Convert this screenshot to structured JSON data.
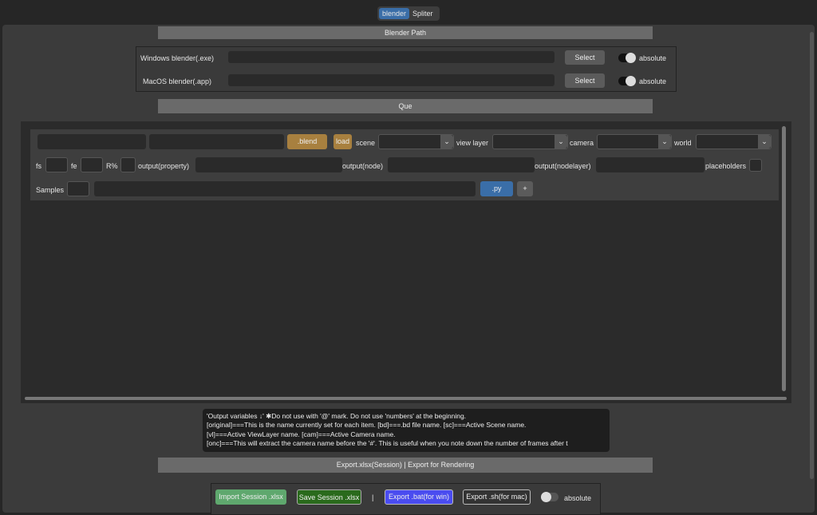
{
  "tabs": [
    {
      "label": "blender",
      "active": true
    },
    {
      "label": "Spliter",
      "active": false
    }
  ],
  "blender_path": {
    "title": "Blender Path",
    "rows": [
      {
        "label": "Windows blender(.exe)",
        "value": "",
        "button": "Select",
        "toggle_label": "absolute",
        "toggle_on": true
      },
      {
        "label": "MacOS blender(.app)",
        "value": "",
        "button": "Select",
        "toggle_label": "absolute",
        "toggle_on": true
      }
    ]
  },
  "que": {
    "title": "Que",
    "item": {
      "blend_button": ".blend",
      "load_button": "load",
      "scene_label": "scene",
      "view_layer_label": "view layer",
      "camera_label": "camera",
      "world_label": "world",
      "fs_label": "fs",
      "fe_label": "fe",
      "r_label": "R%",
      "output_property_label": "output(property)",
      "output_node_label": "output(node)",
      "output_nodelayer_label": "output(nodelayer)",
      "placeholders_label": "placeholders",
      "samples_label": "Samples",
      "py_button": ".py",
      "add_button": "+"
    }
  },
  "info": [
    "'Output variables ↓'    ✱Do not use with '@' mark. Do not use 'numbers' at the beginning.",
    "[original]===This is the name currently set for each item.      [bd]===.bd file name.      [sc]===Active Scene name.",
    "[vl]===Active ViewLayer name.      [cam]===Active Camera name.",
    "[onc]===This will extract the camera name before the '#'. This is useful when you note down the number of frames after t"
  ],
  "export": {
    "title": "Export.xlsx(Session)   |   Export for Rendering",
    "import_button": "Import Session .xlsx",
    "save_button": "Save Session .xlsx",
    "separator": "|",
    "bat_button": "Export .bat(for win)",
    "sh_button": "Export .sh(for mac)",
    "toggle_label": "absolute",
    "toggle_on": false
  },
  "colors": {
    "accent": "#3a6ea8",
    "blend": "#a8803f",
    "import": "#5fa86e",
    "save": "#2a6a1c",
    "bat": "#4a4cf0"
  }
}
